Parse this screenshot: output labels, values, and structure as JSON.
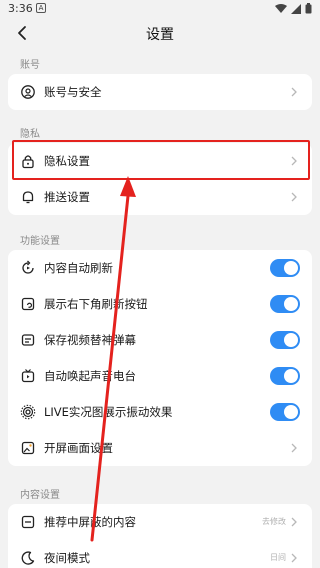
{
  "status": {
    "time": "3:36",
    "notif": "A"
  },
  "header": {
    "title": "设置"
  },
  "sections": {
    "account": {
      "label": "账号",
      "items": [
        {
          "label": "账号与安全"
        }
      ]
    },
    "privacy": {
      "label": "隐私",
      "items": [
        {
          "label": "隐私设置"
        },
        {
          "label": "推送设置"
        }
      ]
    },
    "function": {
      "label": "功能设置",
      "items": [
        {
          "label": "内容自动刷新",
          "on": true
        },
        {
          "label": "展示右下角刷新按钮",
          "on": true
        },
        {
          "label": "保存视频替神弹幕",
          "on": true
        },
        {
          "label": "自动唤起声音电台",
          "on": true
        },
        {
          "label": "LIVE实况图展示振动效果",
          "on": true
        },
        {
          "label": "开屏画面设置"
        }
      ]
    },
    "content": {
      "label": "内容设置",
      "items": [
        {
          "label": "推荐中屏蔽的内容",
          "value": "去修改"
        },
        {
          "label": "夜间模式",
          "value": "日间"
        }
      ]
    }
  },
  "icons": {
    "account": "account-icon",
    "lock": "lock-icon",
    "bell": "bell-icon",
    "refresh": "refresh-icon",
    "button": "refresh-button-icon",
    "save": "save-video-icon",
    "radio": "radio-icon",
    "live": "live-icon",
    "splash": "splash-icon",
    "block": "block-icon",
    "moon": "moon-icon"
  },
  "colors": {
    "accent": "#2f8cf4",
    "annotation": "#e4221e",
    "background": "#f2f2f2"
  }
}
